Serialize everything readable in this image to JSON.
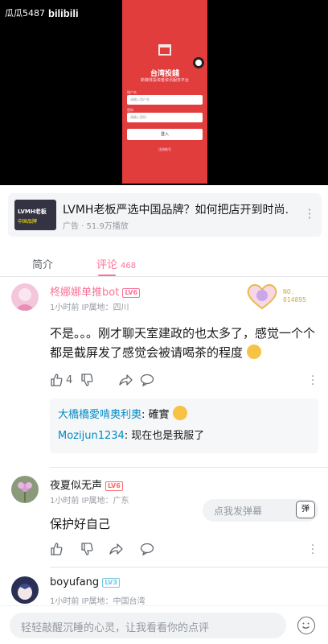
{
  "video": {
    "uploader": "瓜瓜5487",
    "brand": "bilibili",
    "app_title": "台湾投錢",
    "app_subtitle": "新媒体投资者资讯服务平台",
    "account_label": "账户名",
    "account_placeholder": "请输入用户名",
    "password_label": "密码",
    "password_placeholder": "请输入密码",
    "login_button": "登入",
    "register_link": "注册帐号"
  },
  "ad": {
    "thumb_line1": "LVMH老板",
    "thumb_line2": "中国品牌",
    "title": "LVMH老板严选中国品牌？如何把店开到时尚…",
    "meta": "广告 · 51.9万播放"
  },
  "tabs": {
    "intro": "简介",
    "comments": "评论",
    "comments_count": "468",
    "danmu_placeholder": "点我发弹幕",
    "danmu_icon": "弹"
  },
  "fan_badge": {
    "label": "NO.",
    "number": "014895"
  },
  "comments": [
    {
      "user": "柊娜娜单推bot",
      "level": "LV6",
      "level_color": "#fb7299",
      "time": "1小时前 IP属地：四川",
      "text": "不是。。。刚才聊天室建政的也太多了，感觉一个个都是截屏发了感觉会被请喝茶的程度",
      "likes": "4",
      "replies": [
        {
          "user": "大橋橋愛啃奧利奧",
          "text": "確實"
        },
        {
          "user": "Mozijun1234",
          "text": "现在也是我服了"
        }
      ]
    },
    {
      "user": "夜夏似无声",
      "level": "LV6",
      "level_color": "#f56c6c",
      "time": "1小时前 IP属地：广东",
      "text": "保护好自己"
    },
    {
      "user": "boyufang",
      "level": "LV3",
      "level_color": "#73c9e5",
      "time": "1小时前 IP属地：中国台湾"
    }
  ],
  "bottom": {
    "placeholder": "轻轻敲醒沉睡的心灵，让我看看你的点评"
  }
}
